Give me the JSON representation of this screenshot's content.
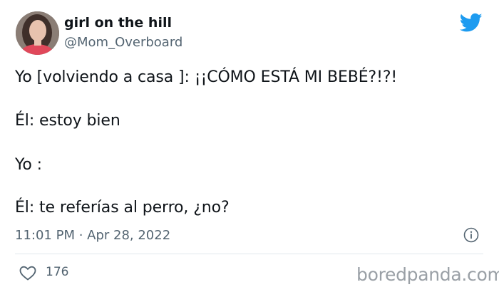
{
  "author": {
    "display_name": "girl on the hill",
    "handle": "@Mom_Overboard"
  },
  "tweet": {
    "lines": [
      "Yo [volviendo a casa ]: ¡¡CÓMO ESTÁ MI BEBÉ?!?!",
      "Él: estoy bien",
      "Yo :",
      "Él: te referías al perro, ¿no?"
    ],
    "meta": "11:01 PM · Apr 28, 2022",
    "likes": "176"
  },
  "watermark": "boredpanda.com",
  "icons": {
    "brand": "twitter-bird-icon",
    "info": "info-icon",
    "like": "heart-icon"
  },
  "colors": {
    "twitter_blue": "#1d9bf0",
    "secondary_text": "#536471",
    "watermark": "#9aa0a6"
  }
}
